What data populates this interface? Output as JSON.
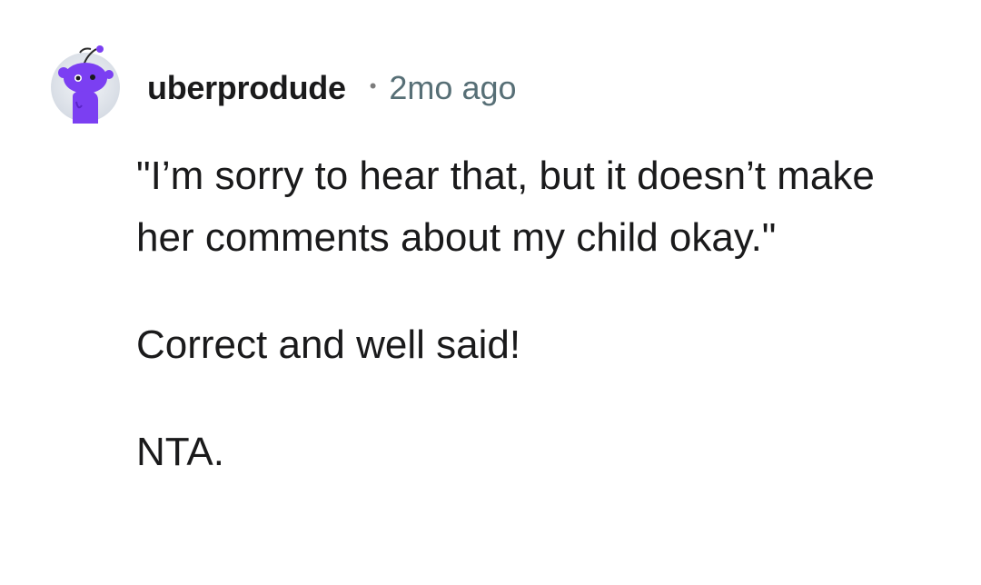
{
  "comment": {
    "author": "uberprodude",
    "separator": "•",
    "timestamp": "2mo ago",
    "avatar_icon": "snoo-avatar-icon",
    "paragraphs": [
      "\"I’m sorry to hear that, but it doesn’t make her comments about my child okay.\"",
      "Correct and well said!",
      "NTA."
    ]
  },
  "colors": {
    "avatar_bg": "#e4e8ef",
    "snoo": "#7b3ff2",
    "timestamp": "#576f76"
  }
}
